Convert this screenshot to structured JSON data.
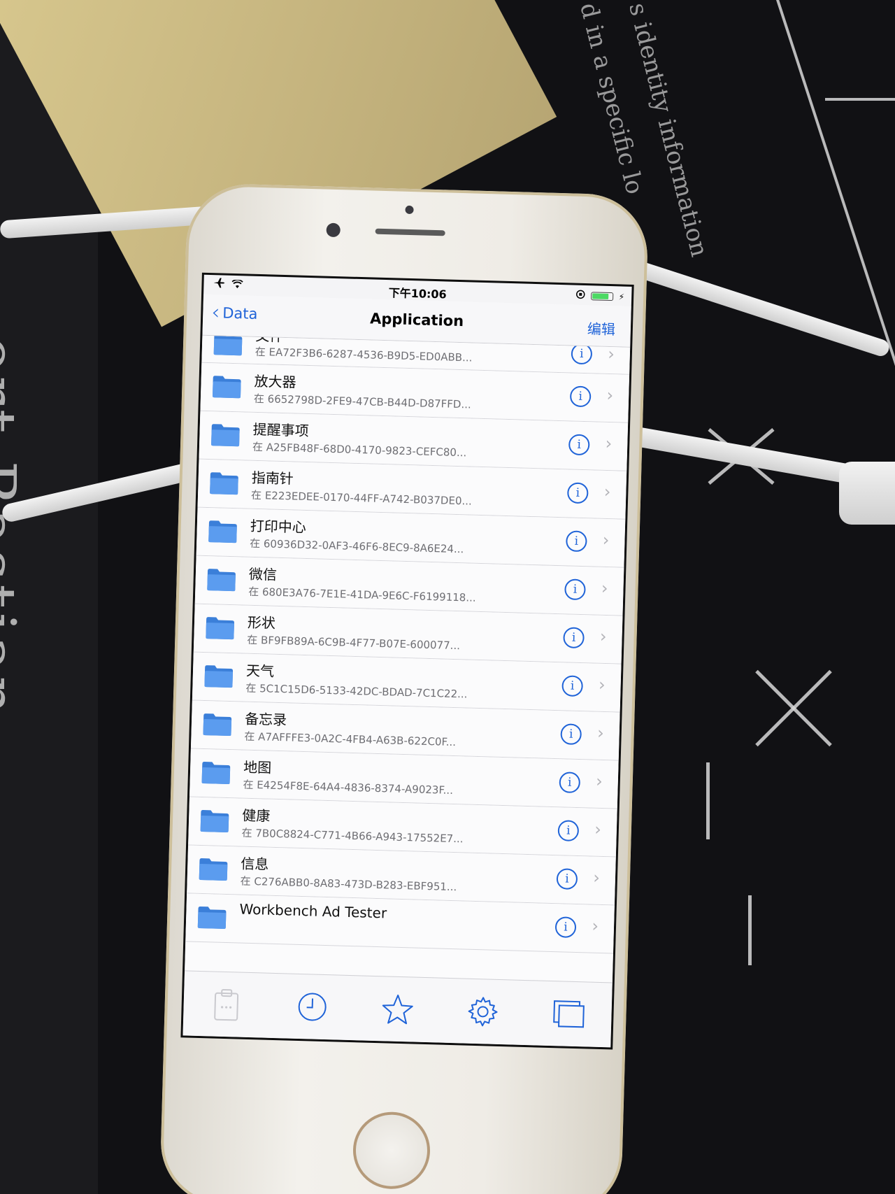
{
  "background": {
    "left_mat_text": "ort Bastian",
    "right_mat_text_1": "s identity information",
    "right_mat_text_2": "d in a specific lo"
  },
  "status_bar": {
    "time": "下午10:06",
    "airplane_icon": "airplane-icon",
    "wifi_icon": "wifi-icon",
    "battery_level": 0.85,
    "battery_color": "#4cd964"
  },
  "nav": {
    "back_label": "Data",
    "title": "Application",
    "edit_label": "编辑",
    "accent_color": "#1f63d8"
  },
  "rows": [
    {
      "title": "文件",
      "subtitle": "在 EA72F3B6-6287-4536-B9D5-ED0ABB..."
    },
    {
      "title": "放大器",
      "subtitle": "在 6652798D-2FE9-47CB-B44D-D87FFD..."
    },
    {
      "title": "提醒事项",
      "subtitle": "在 A25FB48F-68D0-4170-9823-CEFC80..."
    },
    {
      "title": "指南针",
      "subtitle": "在 E223EDEE-0170-44FF-A742-B037DE0..."
    },
    {
      "title": "打印中心",
      "subtitle": "在 60936D32-0AF3-46F6-8EC9-8A6E24..."
    },
    {
      "title": "微信",
      "subtitle": "在 680E3A76-7E1E-41DA-9E6C-F6199118..."
    },
    {
      "title": "形状",
      "subtitle": "在 BF9FB89A-6C9B-4F77-B07E-600077..."
    },
    {
      "title": "天气",
      "subtitle": "在 5C1C15D6-5133-42DC-BDAD-7C1C22..."
    },
    {
      "title": "备忘录",
      "subtitle": "在 A7AFFFE3-0A2C-4FB4-A63B-622C0F..."
    },
    {
      "title": "地图",
      "subtitle": "在 E4254F8E-64A4-4836-8374-A9023F..."
    },
    {
      "title": "健康",
      "subtitle": "在 7B0C8824-C771-4B66-A943-17552E7..."
    },
    {
      "title": "信息",
      "subtitle": "在 C276ABB0-8A83-473D-B283-EBF951..."
    },
    {
      "title": "Workbench Ad Tester",
      "subtitle": ""
    }
  ],
  "tabs": [
    {
      "icon": "clipboard-icon"
    },
    {
      "icon": "clock-icon"
    },
    {
      "icon": "star-icon"
    },
    {
      "icon": "gear-icon"
    },
    {
      "icon": "windows-icon"
    }
  ]
}
